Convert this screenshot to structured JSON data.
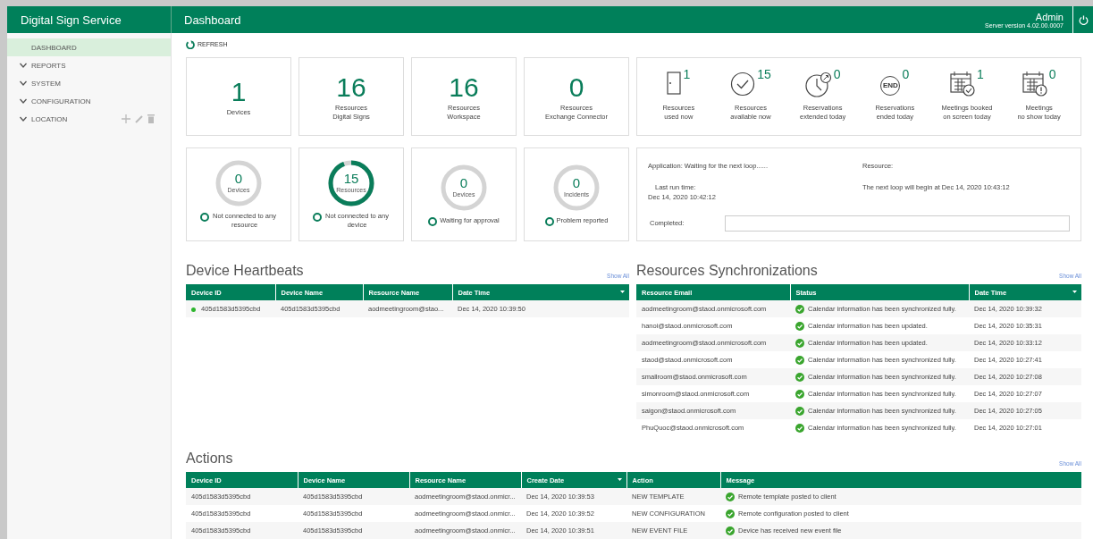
{
  "app": {
    "title": "Digital Sign Service"
  },
  "header": {
    "title": "Dashboard",
    "user": "Admin",
    "server_version": "Server version 4.02.00.0007"
  },
  "sidebar": {
    "items": [
      {
        "label": "DASHBOARD",
        "kind": "link",
        "selected": true
      },
      {
        "label": "REPORTS",
        "kind": "group",
        "selected": false,
        "expanded": false
      },
      {
        "label": "SYSTEM",
        "kind": "group",
        "selected": false,
        "expanded": false
      },
      {
        "label": "CONFIGURATION",
        "kind": "group",
        "selected": false,
        "expanded": false
      },
      {
        "label": "LOCATION",
        "kind": "group",
        "selected": false,
        "expanded": false,
        "actions": true
      }
    ]
  },
  "refresh": {
    "label": "REFRESH"
  },
  "counters": [
    {
      "value": "1",
      "label": "Devices"
    },
    {
      "value": "16",
      "label": "Resources",
      "sublabel": "Digital Signs"
    },
    {
      "value": "16",
      "label": "Resources",
      "sublabel": "Workspace"
    },
    {
      "value": "0",
      "label": "Resources",
      "sublabel": "Exchange Connector"
    }
  ],
  "stats": [
    {
      "kind": "door",
      "value": "1",
      "label": "Resources",
      "sublabel": "used now"
    },
    {
      "kind": "check",
      "value": "15",
      "label": "Resources",
      "sublabel": "available now"
    },
    {
      "kind": "clock",
      "value": "0",
      "label": "Reservations",
      "sublabel": "extended today"
    },
    {
      "kind": "end",
      "badge": "END",
      "value": "0",
      "label": "Reservations",
      "sublabel": "ended today"
    },
    {
      "kind": "calendar_check",
      "value": "1",
      "label": "Meetings booked",
      "sublabel": "on screen today"
    },
    {
      "kind": "calendar_alert",
      "value": "0",
      "label": "Meetings",
      "sublabel": "no show today"
    }
  ],
  "gauges": [
    {
      "value": "0",
      "label": "Devices",
      "level": 0,
      "status": "Not connected to any resource"
    },
    {
      "value": "15",
      "label": "Resources",
      "level": 0.9375,
      "status": "Not connected to any device"
    },
    {
      "value": "0",
      "label": "Devices",
      "level": 0,
      "status": "Waiting for approval"
    },
    {
      "value": "0",
      "label": "Incidents",
      "level": 0,
      "status": "Problem reported"
    }
  ],
  "sync_status": {
    "application": "Application: Waiting for the next loop......",
    "resource": "Resource:",
    "last_run_label": "Last run time:",
    "last_run": "Dec 14, 2020 10:42:12",
    "next_loop": "The next loop will begin at Dec 14, 2020 10:43:12",
    "completed": {
      "label": "Completed:",
      "level": 0
    }
  },
  "heartbeats": {
    "title": "Device Heartbeats",
    "show_all": "Show All",
    "columns": [
      {
        "label": "Device ID",
        "sorted": false
      },
      {
        "label": "Device Name",
        "sorted": false
      },
      {
        "label": "Resource Name",
        "sorted": false
      },
      {
        "label": "Date Time",
        "sorted": true
      }
    ],
    "rows": [
      {
        "color": "#2db52d",
        "cells": [
          "405d1583d5395cbd",
          "405d1583d5395cbd",
          "aodmeetingroom@stao...",
          "Dec 14, 2020 10:39:50"
        ]
      }
    ]
  },
  "synchronizations": {
    "title": "Resources Synchronizations",
    "show_all": "Show All",
    "columns": [
      {
        "label": "Resource Email",
        "sorted": false
      },
      {
        "label": "Status",
        "sorted": false
      },
      {
        "label": "Date Time",
        "sorted": true
      }
    ],
    "rows": [
      [
        "aodmeetingroom@staod.onmicrosoft.com",
        "Calendar information has been synchronized fully.",
        "Dec 14, 2020 10:39:32"
      ],
      [
        "hanoi@staod.onmicrosoft.com",
        "Calendar information has been updated.",
        "Dec 14, 2020 10:35:31"
      ],
      [
        "aodmeetingroom@staod.onmicrosoft.com",
        "Calendar information has been updated.",
        "Dec 14, 2020 10:33:12"
      ],
      [
        "staod@staod.onmicrosoft.com",
        "Calendar information has been synchronized fully.",
        "Dec 14, 2020 10:27:41"
      ],
      [
        "smallroom@staod.onmicrosoft.com",
        "Calendar information has been synchronized fully.",
        "Dec 14, 2020 10:27:08"
      ],
      [
        "simonroom@staod.onmicrosoft.com",
        "Calendar information has been synchronized fully.",
        "Dec 14, 2020 10:27:07"
      ],
      [
        "saigon@staod.onmicrosoft.com",
        "Calendar information has been synchronized fully.",
        "Dec 14, 2020 10:27:05"
      ],
      [
        "PhuQuoc@staod.onmicrosoft.com",
        "Calendar information has been synchronized fully.",
        "Dec 14, 2020 10:27:01"
      ]
    ]
  },
  "actions": {
    "title": "Actions",
    "show_all": "Show All",
    "columns": [
      {
        "label": "Device ID",
        "sorted": false
      },
      {
        "label": "Device Name",
        "sorted": false
      },
      {
        "label": "Resource Name",
        "sorted": false
      },
      {
        "label": "Create Date",
        "sorted": true
      },
      {
        "label": "Action",
        "sorted": false
      },
      {
        "label": "Message",
        "sorted": false
      }
    ],
    "rows": [
      [
        "405d1583d5395cbd",
        "405d1583d5395cbd",
        "aodmeetingroom@staod.onmicr...",
        "Dec 14, 2020 10:39:53",
        "NEW TEMPLATE",
        "Remote template posted to client"
      ],
      [
        "405d1583d5395cbd",
        "405d1583d5395cbd",
        "aodmeetingroom@staod.onmicr...",
        "Dec 14, 2020 10:39:52",
        "NEW CONFIGURATION",
        "Remote configuration posted to client"
      ],
      [
        "405d1583d5395cbd",
        "405d1583d5395cbd",
        "aodmeetingroom@staod.onmicr...",
        "Dec 14, 2020 10:39:51",
        "NEW EVENT FILE",
        "Device has received new event file"
      ]
    ]
  }
}
